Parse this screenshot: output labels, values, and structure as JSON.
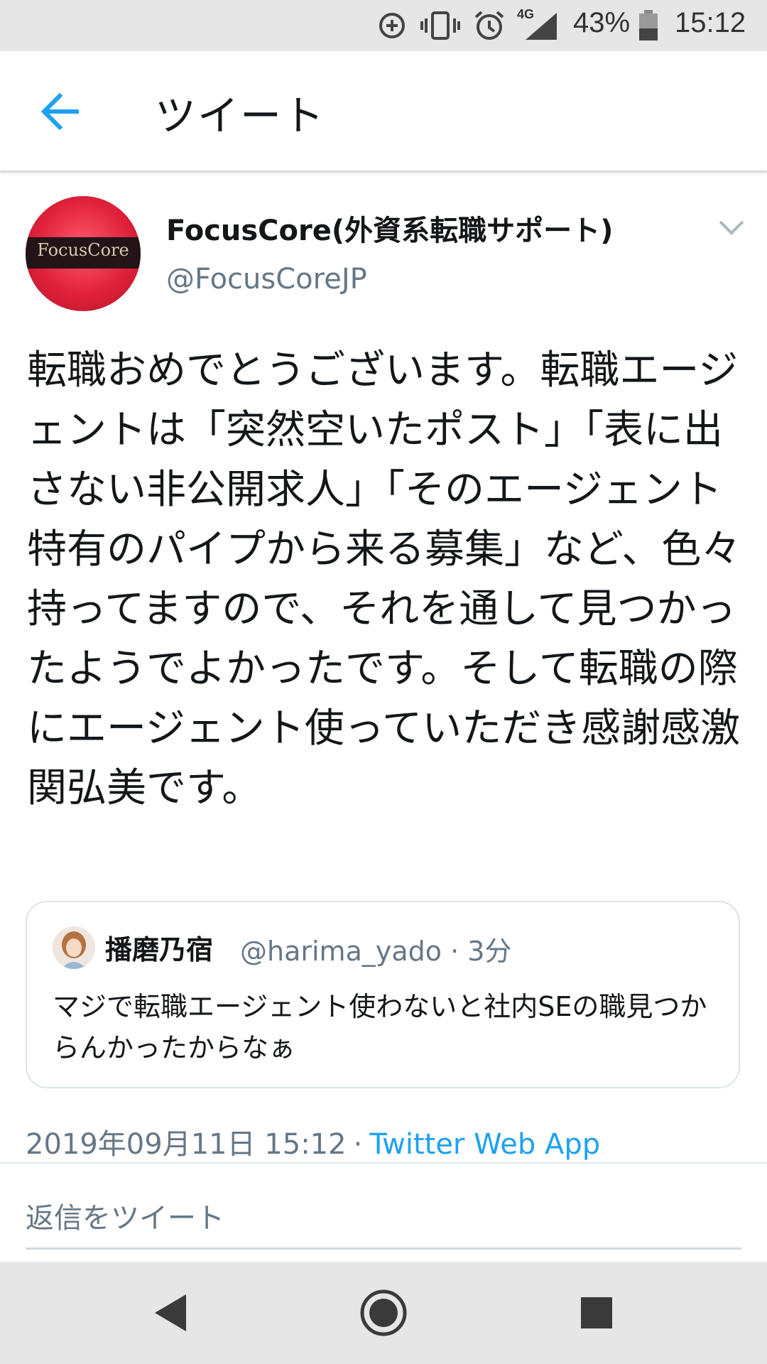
{
  "status_bar": {
    "battery_percent": "43%",
    "time": "15:12",
    "network": "4G",
    "icons": [
      "data-saver-icon",
      "vibrate-icon",
      "alarm-icon",
      "signal-icon",
      "battery-icon"
    ]
  },
  "app_bar": {
    "title": "ツイート",
    "back_icon": "back-arrow-icon"
  },
  "tweet": {
    "author": {
      "display_name": "FocusCore(外資系転職サポート)",
      "handle": "@FocusCoreJP",
      "avatar_text": "FocusCore"
    },
    "text": "転職おめでとうございます。転職エージェントは「突然空いたポスト」「表に出さない非公開求人」「そのエージェント特有のパイプから来る募集」など、色々持ってますので、それを通して見つかったようでよかったです。そして転職の際にエージェント使っていただき感謝感激関弘美です。",
    "quoted": {
      "display_name": "播磨乃宿",
      "handle": "@harima_yado · 3分",
      "text": "マジで転職エージェント使わないと社内SEの職見つからんかったからなぁ"
    },
    "timestamp": "2019年09月11日 15:12",
    "separator": "·",
    "client": "Twitter Web App"
  },
  "reply": {
    "placeholder": "返信をツイート"
  },
  "colors": {
    "accent": "#1da1f2",
    "secondary_text": "#657786",
    "primary_text": "#14171a"
  }
}
